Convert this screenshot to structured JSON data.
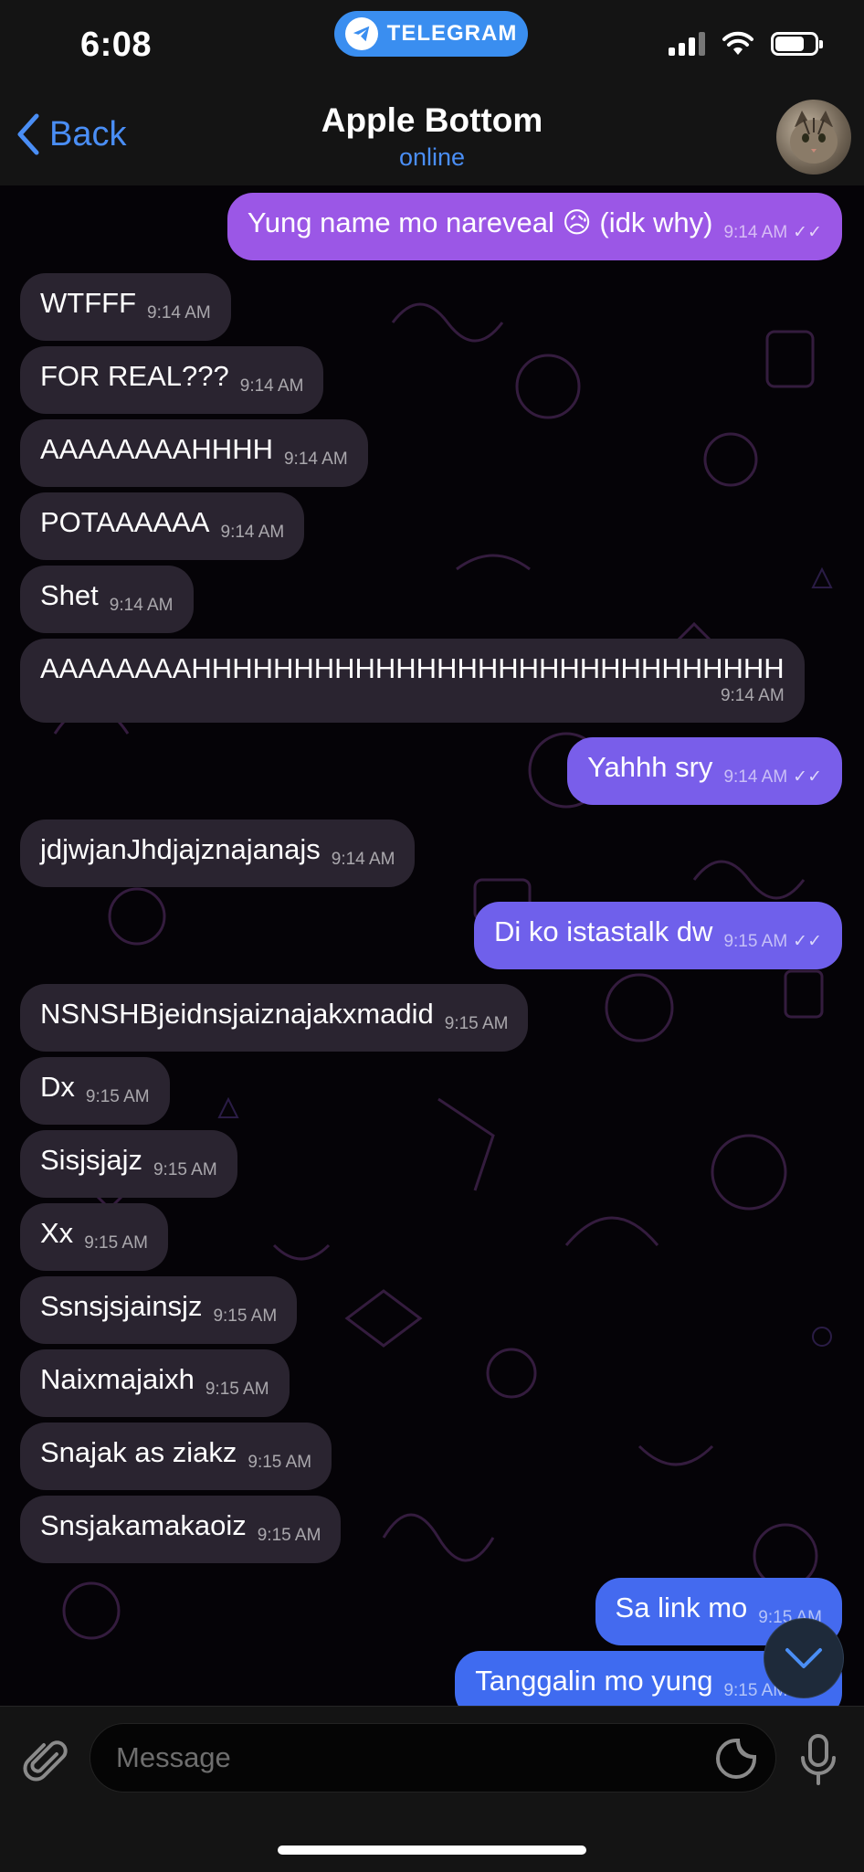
{
  "status_bar": {
    "time": "6:08",
    "pill_label": "TELEGRAM",
    "icons": [
      "signal-icon",
      "wifi-icon",
      "battery-icon"
    ],
    "battery_level": 0.7
  },
  "header": {
    "back_label": "Back",
    "title": "Apple Bottom",
    "status": "online",
    "avatar_icon": "cat-avatar"
  },
  "colors": {
    "accent": "#4a8ef5",
    "incoming_bubble": "#2a2430",
    "outgoing_top": "#9b57e6",
    "outgoing_bottom": "#3f6bf0",
    "pill": "#3a8ef0"
  },
  "messages": [
    {
      "dir": "out",
      "text": "Yung name mo nareveal 😥 (idk why)",
      "time": "9:14 AM",
      "read": true
    },
    {
      "dir": "in",
      "text": "WTFFF",
      "time": "9:14 AM"
    },
    {
      "dir": "in",
      "text": "FOR REAL???",
      "time": "9:14 AM"
    },
    {
      "dir": "in",
      "text": "AAAAAAAAHHHH",
      "time": "9:14 AM"
    },
    {
      "dir": "in",
      "text": "POTAAAAAA",
      "time": "9:14 AM"
    },
    {
      "dir": "in",
      "text": "Shet",
      "time": "9:14 AM"
    },
    {
      "dir": "in",
      "text": "AAAAAAAAHHHHHHHHHHHHHHHHHHHHHHHHHHHHH",
      "time": "9:14 AM"
    },
    {
      "dir": "out",
      "text": "Yahhh sry",
      "time": "9:14 AM",
      "read": true
    },
    {
      "dir": "in",
      "text": "jdjwjanJhdjajznajanajs",
      "time": "9:14 AM"
    },
    {
      "dir": "out",
      "text": "Di ko istastalk dw",
      "time": "9:15 AM",
      "read": true
    },
    {
      "dir": "in",
      "text": "NSNSHBjeidnsjaiznajakxmadid",
      "time": "9:15 AM"
    },
    {
      "dir": "in",
      "text": "Dx",
      "time": "9:15 AM"
    },
    {
      "dir": "in",
      "text": "Sisjsjajz",
      "time": "9:15 AM"
    },
    {
      "dir": "in",
      "text": "Xx",
      "time": "9:15 AM"
    },
    {
      "dir": "in",
      "text": "Ssnsjsjainsjz",
      "time": "9:15 AM"
    },
    {
      "dir": "in",
      "text": "Naixmajaixh",
      "time": "9:15 AM"
    },
    {
      "dir": "in",
      "text": "Snajak as ziakz",
      "time": "9:15 AM"
    },
    {
      "dir": "in",
      "text": "Snsjakamakaoiz",
      "time": "9:15 AM"
    },
    {
      "dir": "out",
      "text": "Sa link mo",
      "time": "9:15 AM",
      "read": false
    },
    {
      "dir": "out",
      "text": "Tanggalin mo yung",
      "time": "9:15 AM",
      "read": true
    }
  ],
  "composer": {
    "placeholder": "Message",
    "attach_icon": "paperclip-icon",
    "sticker_icon": "sticker-icon",
    "mic_icon": "microphone-icon"
  },
  "scroll_button_icon": "chevron-down-icon"
}
